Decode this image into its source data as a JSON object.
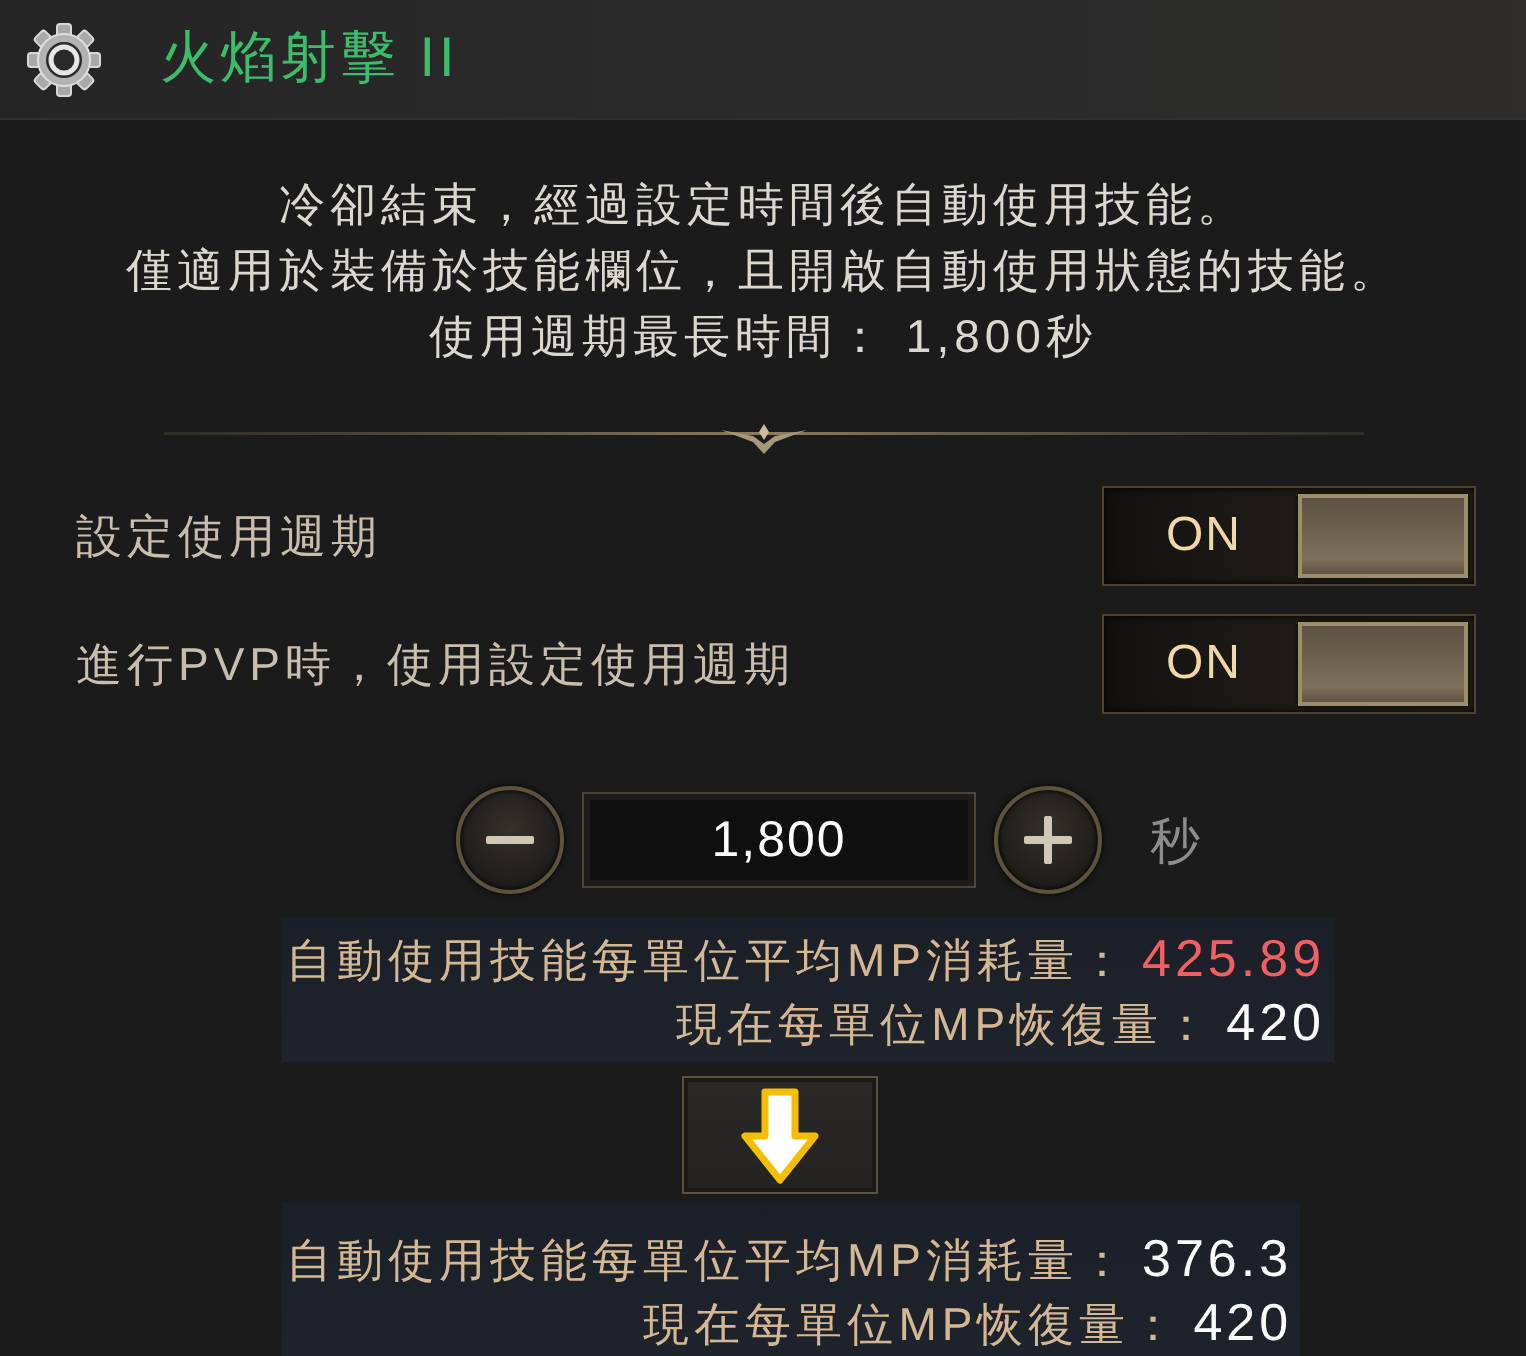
{
  "header": {
    "title": "火焰射擊 II"
  },
  "description": [
    "冷卻結束，經過設定時間後自動使用技能。",
    "僅適用於裝備於技能欄位，且開啟自動使用狀態的技能。",
    "使用週期最長時間： 1,800秒"
  ],
  "settings": [
    {
      "label": "設定使用週期",
      "toggle_text": "ON",
      "on": true
    },
    {
      "label": "進行PVP時，使用設定使用週期",
      "toggle_text": "ON",
      "on": true
    }
  ],
  "interval": {
    "value": "1,800",
    "unit": "秒"
  },
  "mp_before": [
    {
      "label": "自動使用技能每單位平均MP消耗量：",
      "value": "425.89",
      "color": "#f25f63"
    },
    {
      "label": "現在每單位MP恢復量：",
      "value": "420",
      "color": "#ffffff"
    }
  ],
  "mp_after": [
    {
      "label": "自動使用技能每單位平均MP消耗量：",
      "value": "376.3",
      "color": "#ffffff"
    },
    {
      "label": "現在每單位MP恢復量：",
      "value": "420",
      "color": "#ffffff"
    }
  ]
}
